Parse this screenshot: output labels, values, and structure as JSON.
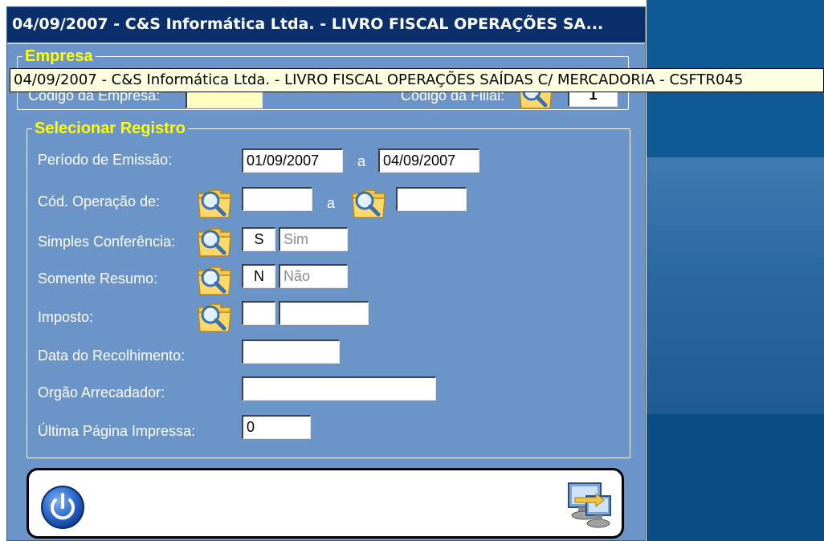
{
  "window": {
    "title": "04/09/2007  -  C&S Informática Ltda.  -  LIVRO FISCAL OPERAÇÕES SA..."
  },
  "tooltip": {
    "text": "04/09/2007  -  C&S Informática Ltda.  -  LIVRO FISCAL OPERAÇÕES SAÍDAS C/ MERCADORIA  -  CSFTR045"
  },
  "empresa": {
    "legend": "Empresa",
    "codigo_empresa_label": "Código da Empresa:",
    "codigo_filial_label": "Código da Filial:",
    "filial_value": "1"
  },
  "registro": {
    "legend": "Selecionar Registro",
    "periodo_label": "Período de Emissão:",
    "periodo_de": "01/09/2007",
    "periodo_sep": "a",
    "periodo_ate": "04/09/2007",
    "cod_operacao_label": "Cód. Operação de:",
    "cod_operacao_sep": "a",
    "cod_operacao_de": "",
    "cod_operacao_ate": "",
    "simples_label": "Simples Conferência:",
    "simples_code": "S",
    "simples_desc": "Sim",
    "resumo_label": "Somente Resumo:",
    "resumo_code": "N",
    "resumo_desc": "Não",
    "imposto_label": "Imposto:",
    "imposto_code": "",
    "imposto_desc": "",
    "data_recolhimento_label": "Data do Recolhimento:",
    "data_recolhimento": "",
    "orgao_label": "Orgão Arrecadador:",
    "orgao": "",
    "ultima_pagina_label": "Última Página Impressa:",
    "ultima_pagina": "0"
  },
  "icons": {
    "lookup": "folder-magnifier-icon",
    "exit": "power-icon",
    "transfer": "computer-transfer-icon"
  },
  "colors": {
    "window_bg": "#6b94c8",
    "titlebar": "#0a2f6a",
    "legend": "#ffff00",
    "desktop": "#0d5a94"
  }
}
